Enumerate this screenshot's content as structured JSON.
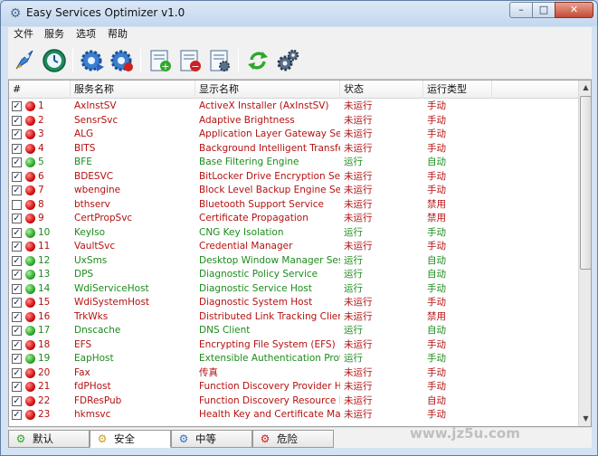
{
  "window": {
    "title": "Easy Services Optimizer v1.0",
    "min": "–",
    "max": "□",
    "close": "✕"
  },
  "menu": [
    "文件",
    "服务",
    "选项",
    "帮助"
  ],
  "columns": [
    "#",
    "服务名称",
    "显示名称",
    "状态",
    "运行类型"
  ],
  "rows": [
    {
      "checked": true,
      "status_color": "red",
      "num": "1",
      "name": "AxInstSV",
      "display": "ActiveX Installer (AxInstSV)",
      "state": "未运行",
      "type": "手动"
    },
    {
      "checked": true,
      "status_color": "red",
      "num": "2",
      "name": "SensrSvc",
      "display": "Adaptive Brightness",
      "state": "未运行",
      "type": "手动"
    },
    {
      "checked": true,
      "status_color": "red",
      "num": "3",
      "name": "ALG",
      "display": "Application Layer Gateway Ser...",
      "state": "未运行",
      "type": "手动"
    },
    {
      "checked": true,
      "status_color": "red",
      "num": "4",
      "name": "BITS",
      "display": "Background Intelligent Transfer...",
      "state": "未运行",
      "type": "手动"
    },
    {
      "checked": true,
      "status_color": "green",
      "num": "5",
      "name": "BFE",
      "display": "Base Filtering Engine",
      "state": "运行",
      "type": "自动"
    },
    {
      "checked": true,
      "status_color": "red",
      "num": "6",
      "name": "BDESVC",
      "display": "BitLocker Drive Encryption Service",
      "state": "未运行",
      "type": "手动"
    },
    {
      "checked": true,
      "status_color": "red",
      "num": "7",
      "name": "wbengine",
      "display": "Block Level Backup Engine Service",
      "state": "未运行",
      "type": "手动"
    },
    {
      "checked": false,
      "status_color": "red",
      "num": "8",
      "name": "bthserv",
      "display": "Bluetooth Support Service",
      "state": "未运行",
      "type": "禁用"
    },
    {
      "checked": true,
      "status_color": "red",
      "num": "9",
      "name": "CertPropSvc",
      "display": "Certificate Propagation",
      "state": "未运行",
      "type": "禁用"
    },
    {
      "checked": true,
      "status_color": "green",
      "num": "10",
      "name": "KeyIso",
      "display": "CNG Key Isolation",
      "state": "运行",
      "type": "手动"
    },
    {
      "checked": true,
      "status_color": "red",
      "num": "11",
      "name": "VaultSvc",
      "display": "Credential Manager",
      "state": "未运行",
      "type": "手动"
    },
    {
      "checked": true,
      "status_color": "green",
      "num": "12",
      "name": "UxSms",
      "display": "Desktop Window Manager Sess...",
      "state": "运行",
      "type": "自动"
    },
    {
      "checked": true,
      "status_color": "green",
      "num": "13",
      "name": "DPS",
      "display": "Diagnostic Policy Service",
      "state": "运行",
      "type": "自动"
    },
    {
      "checked": true,
      "status_color": "green",
      "num": "14",
      "name": "WdiServiceHost",
      "display": "Diagnostic Service Host",
      "state": "运行",
      "type": "手动"
    },
    {
      "checked": true,
      "status_color": "red",
      "num": "15",
      "name": "WdiSystemHost",
      "display": "Diagnostic System Host",
      "state": "未运行",
      "type": "手动"
    },
    {
      "checked": true,
      "status_color": "red",
      "num": "16",
      "name": "TrkWks",
      "display": "Distributed Link Tracking Client",
      "state": "未运行",
      "type": "禁用"
    },
    {
      "checked": true,
      "status_color": "green",
      "num": "17",
      "name": "Dnscache",
      "display": "DNS Client",
      "state": "运行",
      "type": "自动"
    },
    {
      "checked": true,
      "status_color": "red",
      "num": "18",
      "name": "EFS",
      "display": "Encrypting File System (EFS)",
      "state": "未运行",
      "type": "手动"
    },
    {
      "checked": true,
      "status_color": "green",
      "num": "19",
      "name": "EapHost",
      "display": "Extensible Authentication Proto...",
      "state": "运行",
      "type": "手动"
    },
    {
      "checked": true,
      "status_color": "red",
      "num": "20",
      "name": "Fax",
      "display": "传真",
      "state": "未运行",
      "type": "手动"
    },
    {
      "checked": true,
      "status_color": "red",
      "num": "21",
      "name": "fdPHost",
      "display": "Function Discovery Provider Host",
      "state": "未运行",
      "type": "手动"
    },
    {
      "checked": true,
      "status_color": "red",
      "num": "22",
      "name": "FDResPub",
      "display": "Function Discovery Resource P...",
      "state": "未运行",
      "type": "自动"
    },
    {
      "checked": true,
      "status_color": "red",
      "num": "23",
      "name": "hkmsvc",
      "display": "Health Key and Certificate Man...",
      "state": "未运行",
      "type": "手动"
    }
  ],
  "tabs": [
    {
      "label": "默认",
      "active": false
    },
    {
      "label": "安全",
      "active": true
    },
    {
      "label": "中等",
      "active": false
    },
    {
      "label": "危险",
      "active": false
    }
  ],
  "watermark": "www.jz5u.com"
}
